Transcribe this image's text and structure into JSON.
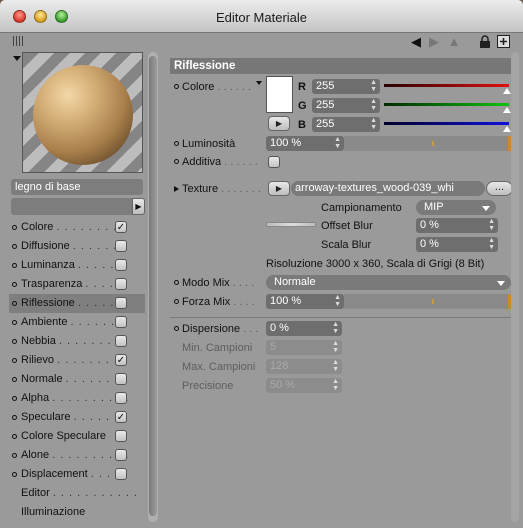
{
  "window": {
    "title": "Editor Materiale"
  },
  "toolbar": {
    "icons": [
      "back-arrow-icon",
      "forward-arrow-icon",
      "up-arrow-icon",
      "lock-icon",
      "new-window-icon"
    ]
  },
  "material": {
    "name": "legno di base",
    "field_value": ""
  },
  "channels": [
    {
      "label": "Colore",
      "dots": ". . . . . . . . .",
      "checked": true
    },
    {
      "label": "Diffusione",
      "dots": ". . . . . .",
      "checked": false
    },
    {
      "label": "Luminanza",
      "dots": ". . . . . .",
      "checked": false
    },
    {
      "label": "Trasparenza",
      "dots": ". . . . .",
      "checked": false
    },
    {
      "label": "Riflessione",
      "dots": ". . . . .",
      "checked": false,
      "selected": true
    },
    {
      "label": "Ambiente",
      "dots": ". . . . . . .",
      "checked": false
    },
    {
      "label": "Nebbia",
      "dots": ". . . . . . . . .",
      "checked": false
    },
    {
      "label": "Rilievo",
      "dots": ". . . . . . . . .",
      "checked": true
    },
    {
      "label": "Normale",
      "dots": ". . . . . . .",
      "checked": false
    },
    {
      "label": "Alpha",
      "dots": ". . . . . . . . . .",
      "checked": false
    },
    {
      "label": "Speculare",
      "dots": ". . . . . .",
      "checked": true
    },
    {
      "label": "Colore Speculare",
      "dots": "",
      "checked": false
    },
    {
      "label": "Alone",
      "dots": ". . . . . . . . . .",
      "checked": false
    },
    {
      "label": "Displacement",
      "dots": ". . .",
      "checked": false
    },
    {
      "label": "Editor",
      "dots": ". . . . . . . . . . .",
      "nocb": true
    },
    {
      "label": "Illuminazione",
      "dots": "",
      "nocb": true
    }
  ],
  "panel": {
    "header": "Riflessione",
    "colore_label": "Colore",
    "colore_dots": ". . . . . .",
    "r_label": "R",
    "r_value": "255",
    "g_label": "G",
    "g_value": "255",
    "b_label": "B",
    "b_value": "255",
    "luminosita_label": "Luminosità",
    "luminosita_value": "100 %",
    "additiva_label": "Additiva",
    "additiva_dots": ". . . . . .",
    "texture_label": "Texture",
    "texture_dots": ". . . . . . .",
    "texture_file": "arroway-textures_wood-039_whi",
    "texture_more": "...",
    "campionamento_label": "Campionamento",
    "campionamento_value": "MIP",
    "offset_blur_label": "Offset Blur",
    "offset_blur_value": "0 %",
    "scala_blur_label": "Scala Blur",
    "scala_blur_value": "0 %",
    "risoluzione": "Risoluzione 3000 x 360, Scala di Grigi (8 Bit)",
    "modo_mix_label": "Modo Mix",
    "modo_mix_dots": ". . . .",
    "modo_mix_value": "Normale",
    "forza_mix_label": "Forza Mix",
    "forza_mix_dots": ". . . .",
    "forza_mix_value": "100 %",
    "dispersione_label": "Dispersione",
    "dispersione_dots": ". . .",
    "dispersione_value": "0 %",
    "min_campioni_label": "Min. Campioni",
    "min_campioni_value": "5",
    "max_campioni_label": "Max. Campioni",
    "max_campioni_value": "128",
    "precisione_label": "Precisione",
    "precisione_value": "50 %"
  },
  "colors": {
    "red_bar": "#e01010",
    "green_bar": "#10c010",
    "blue_bar": "#1010d8",
    "accent_fill": "#c88a2a"
  }
}
